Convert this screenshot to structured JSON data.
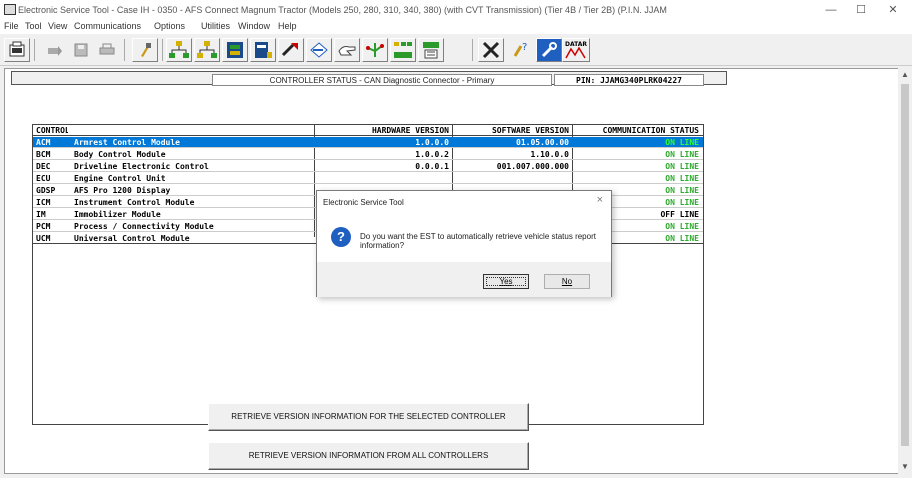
{
  "window": {
    "title": "Electronic Service Tool - Case IH - 0350 - AFS Connect Magnum Tractor (Models 250, 280, 310, 340, 380) (with CVT Transmission) (Tier 4B / Tier 2B) (P.I.N. JJAM",
    "controls": {
      "minimize": "—",
      "maximize": "☐",
      "close": "✕"
    }
  },
  "menu": [
    "File",
    "Tool",
    "View",
    "Communications",
    "Options",
    "Utilities",
    "Window",
    "Help"
  ],
  "toolbar": {
    "icons": [
      "est-logo-icon",
      "connect-icon",
      "save-icon",
      "print-icon",
      "tool-icon",
      "network-icon",
      "network-alt-icon",
      "module-icon",
      "module-alt-icon",
      "arrow-icon",
      "diamond-arrow-icon",
      "hand-icon",
      "tree-icon",
      "group-icon",
      "options-icon",
      "wrench-cross-icon",
      "help-tool-icon",
      "settings-wrench-icon",
      "datar-icon"
    ],
    "datar_label": "DATAR"
  },
  "header": {
    "status_label": "CONTROLLER STATUS  -  CAN Diagnostic Connector - Primary",
    "pin_label": "PIN:  JJAMG340PLRK04227"
  },
  "table": {
    "columns": [
      "CONTROLLER",
      "HARDWARE VERSION",
      "SOFTWARE VERSION",
      "COMMUNICATION STATUS"
    ],
    "rows": [
      {
        "code": "ACM",
        "name": "Armrest Control Module",
        "hw": "1.0.0.0",
        "sw": "01.05.00.00",
        "status": "ON LINE",
        "selected": true
      },
      {
        "code": "BCM",
        "name": "Body Control Module",
        "hw": "1.0.0.2",
        "sw": "1.10.0.0",
        "status": "ON LINE"
      },
      {
        "code": "DEC",
        "name": "Driveline Electronic Control",
        "hw": "0.0.0.1",
        "sw": "001.007.000.000",
        "status": "ON LINE"
      },
      {
        "code": "ECU",
        "name": "Engine Control Unit",
        "hw": "",
        "sw": "",
        "status": "ON LINE"
      },
      {
        "code": "GDSP",
        "name": "AFS Pro 1200 Display",
        "hw": "",
        "sw": "",
        "status": "ON LINE"
      },
      {
        "code": "ICM",
        "name": "Instrument Control Module",
        "hw": "",
        "sw": "",
        "status": "ON LINE"
      },
      {
        "code": "IM",
        "name": "Immobilizer Module",
        "hw": "",
        "sw": "",
        "status": "OFF LINE"
      },
      {
        "code": "PCM",
        "name": "Process / Connectivity Module",
        "hw": "",
        "sw": "",
        "status": "ON LINE"
      },
      {
        "code": "UCM",
        "name": "Universal Control Module",
        "hw": "",
        "sw": "",
        "status": "ON LINE"
      }
    ],
    "colors": {
      "online": "#2eaa2e",
      "offline": "#000000",
      "selection": "#0078d7"
    }
  },
  "buttons": {
    "retrieve_selected": "RETRIEVE VERSION INFORMATION FOR THE SELECTED CONTROLLER",
    "retrieve_all": "RETRIEVE VERSION INFORMATION FROM ALL CONTROLLERS"
  },
  "dialog": {
    "title": "Electronic Service Tool",
    "message": "Do you want the EST to automatically retrieve vehicle status report information?",
    "yes": "Yes",
    "no": "No",
    "close": "×"
  }
}
